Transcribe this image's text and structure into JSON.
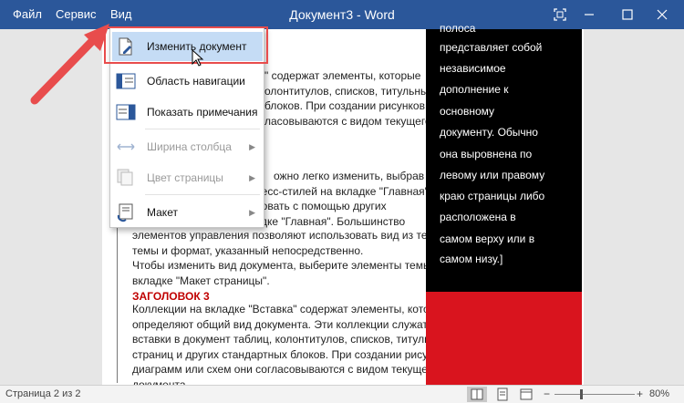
{
  "titlebar": {
    "menu": [
      "Файл",
      "Сервис",
      "Вид"
    ],
    "title": "Документ3 - Word"
  },
  "view_menu": {
    "items": [
      {
        "label": "Изменить документ",
        "icon": "edit-document-icon",
        "state": "highlighted"
      },
      {
        "label": "Область навигации",
        "icon": "navigation-pane-icon",
        "state": "normal"
      },
      {
        "label": "Показать примечания",
        "icon": "comments-icon",
        "state": "normal"
      },
      {
        "label": "Ширина столбца",
        "icon": "column-width-icon",
        "state": "disabled",
        "submenu": true
      },
      {
        "label": "Цвет страницы",
        "icon": "page-color-icon",
        "state": "disabled",
        "submenu": true
      },
      {
        "label": "Макет",
        "icon": "layout-icon",
        "state": "normal",
        "submenu": true
      }
    ]
  },
  "document": {
    "para1": [
      "\" содержат элементы, которые",
      "олонтитулов, списков, титульных",
      "блоков. При создании рисунков,",
      "ласовываются с видом текущего"
    ],
    "para2": [
      "ожно легко изменить, выбрав",
      "экспресс-стилей на вкладке \"Главная\".",
      "ровать с помощью других",
      "дке \"Главная\". Большинство",
      "элементов управления позволяют использовать вид из текущей",
      "темы и формат, указанный непосредственно."
    ],
    "para3": [
      "Чтобы изменить вид документа, выберите элементы темы на",
      "вкладке \"Макет страницы\"."
    ],
    "heading": "ЗАГОЛОВОК 3",
    "para4": [
      "Коллекции на вкладке \"Вставка\" содержат элементы, которые",
      "определяют общий вид документа. Эти коллекции служат для",
      "вставки в документ таблиц, колонтитулов, списков, титульных",
      "страниц и других стандартных блоков. При создании рисунков,",
      "диаграмм или схем они согласовываются с видом текущего",
      "документа."
    ]
  },
  "sidebar": {
    "lines": [
      "полоса",
      "представляет собой",
      "независимое",
      "дополнение к",
      "основному",
      "документу. Обычно",
      "она выровнена по",
      "левому или правому",
      "краю страницы либо",
      "расположена в",
      "самом верху или в",
      "самом низу.]"
    ]
  },
  "status": {
    "page": "Страница 2 из 2",
    "zoom": "80%"
  },
  "colors": {
    "titlebar": "#2b579a",
    "sidebar_black": "#000000",
    "sidebar_red": "#d9141e",
    "highlight_box": "#e84c4c",
    "arrow": "#e84c4c"
  }
}
